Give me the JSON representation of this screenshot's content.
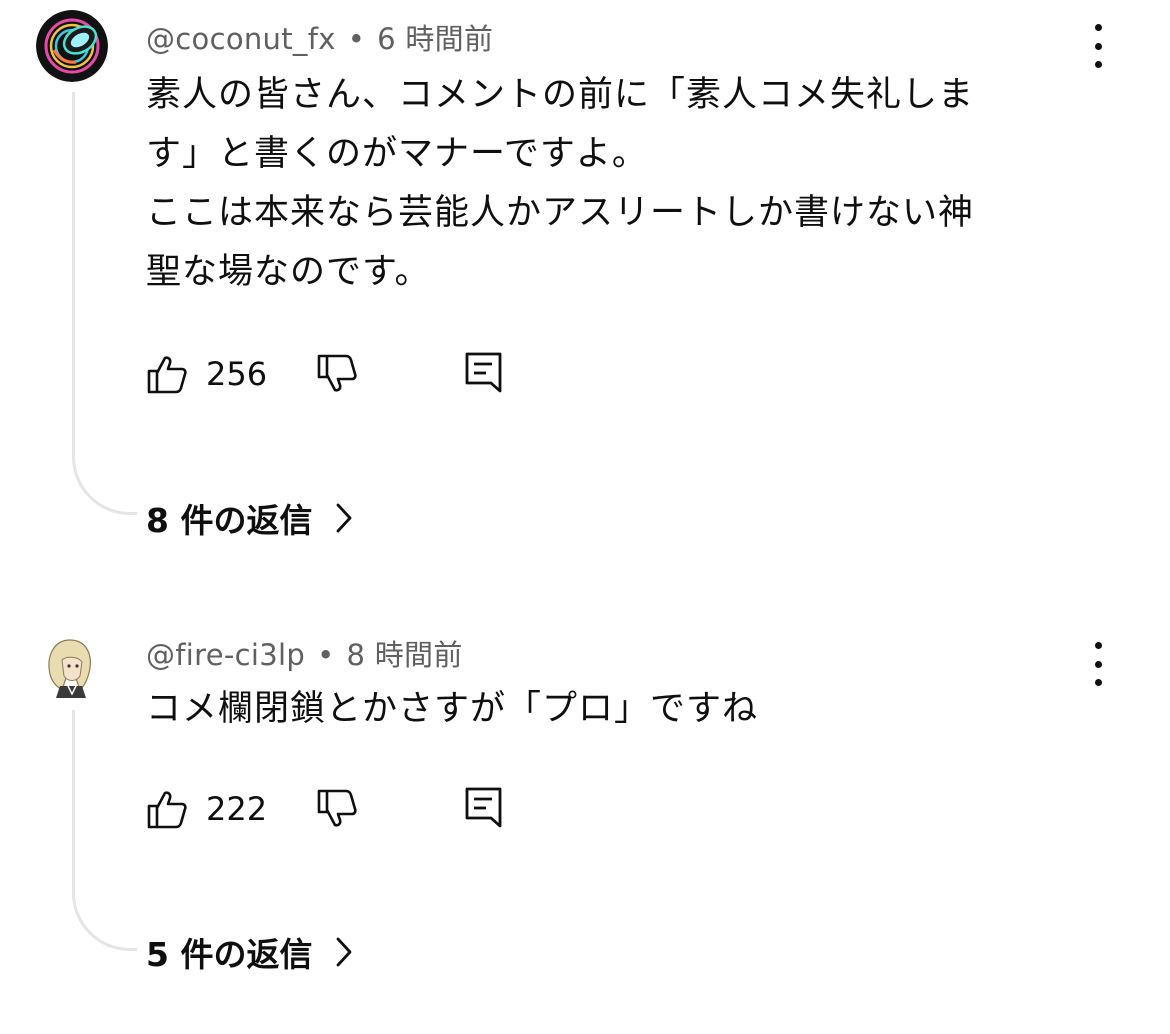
{
  "comments": [
    {
      "handle": "@coconut_fx",
      "separator": "•",
      "time": "6 時間前",
      "lines": [
        "素人の皆さん、コメントの前に「素人コメ失礼しま",
        "す」と書くのがマナーですよ。",
        "ここは本来なら芸能人かアスリートしか書けない神",
        "聖な場なのです。"
      ],
      "likes": "256",
      "replies_label": "8 件の返信"
    },
    {
      "handle": "@fire-ci3lp",
      "separator": "•",
      "time": "8 時間前",
      "lines": [
        "コメ欄閉鎖とかさすが「プロ」ですね"
      ],
      "likes": "222",
      "replies_label": "5 件の返信"
    }
  ],
  "icons": {
    "like": "thumbs-up-icon",
    "dislike": "thumbs-down-icon",
    "reply": "reply-comment-icon",
    "more": "more-vertical-icon",
    "chevron": "chevron-right-icon"
  },
  "colors": {
    "text": "#0f0f0f",
    "meta": "#606060",
    "thread_line": "#e5e5e5"
  }
}
